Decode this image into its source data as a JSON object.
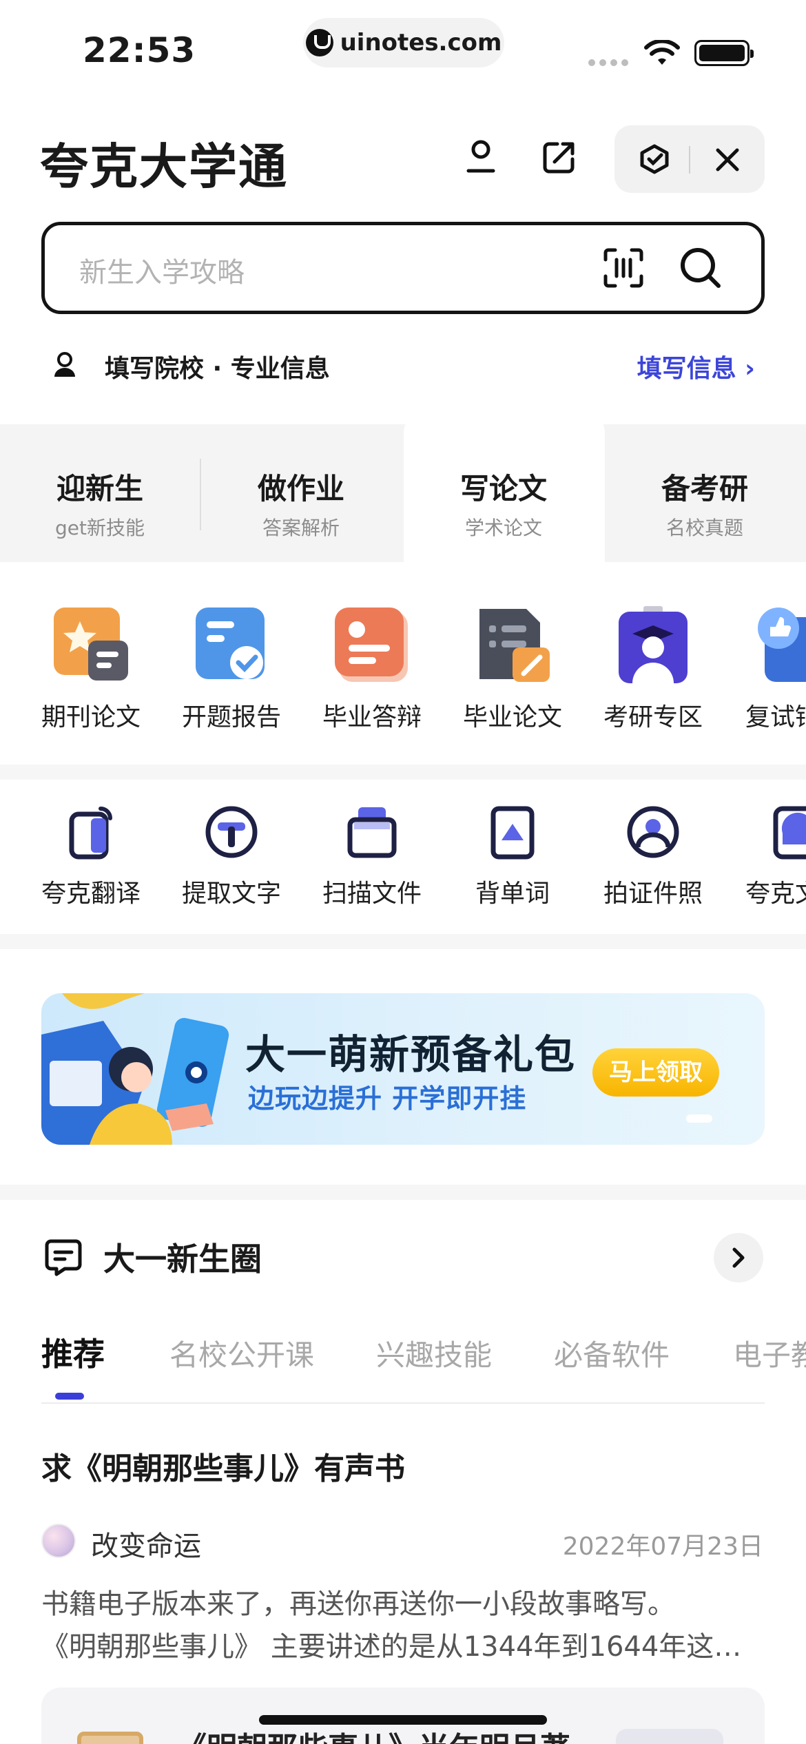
{
  "status_bar": {
    "time": "22:53",
    "url": "uinotes.com"
  },
  "header": {
    "title": "夸克大学通"
  },
  "search": {
    "placeholder": "新生入学攻略"
  },
  "info_row": {
    "label": "填写院校 · 专业信息",
    "link": "填写信息 ›"
  },
  "categories": [
    {
      "title": "迎新生",
      "sub": "get新技能"
    },
    {
      "title": "做作业",
      "sub": "答案解析"
    },
    {
      "title": "写论文",
      "sub": "学术论文",
      "active": true
    },
    {
      "title": "备考研",
      "sub": "名校真题"
    }
  ],
  "tools_row1": [
    {
      "label": "期刊论文",
      "icon": "journal-paper-icon"
    },
    {
      "label": "开题报告",
      "icon": "proposal-report-icon"
    },
    {
      "label": "毕业答辩",
      "icon": "graduation-defense-icon"
    },
    {
      "label": "毕业论文",
      "icon": "graduation-thesis-icon"
    },
    {
      "label": "考研专区",
      "icon": "postgrad-zone-icon"
    },
    {
      "label": "复试锦",
      "icon": "retest-icon"
    }
  ],
  "tools_row2": [
    {
      "label": "夸克翻译",
      "icon": "translate-icon"
    },
    {
      "label": "提取文字",
      "icon": "extract-text-icon"
    },
    {
      "label": "扫描文件",
      "icon": "scan-file-icon"
    },
    {
      "label": "背单词",
      "icon": "vocabulary-icon"
    },
    {
      "label": "拍证件照",
      "icon": "id-photo-icon"
    },
    {
      "label": "夸克文",
      "icon": "quark-doc-icon"
    }
  ],
  "banner": {
    "title": "大一萌新预备礼包",
    "subtitle": "边玩边提升 开学即开挂",
    "button": "马上领取"
  },
  "community": {
    "title": "大一新生圈",
    "tabs": [
      "推荐",
      "名校公开课",
      "兴趣技能",
      "必备软件",
      "电子教"
    ]
  },
  "post": {
    "title": "求《明朝那些事儿》有声书",
    "author": "改变命运",
    "date": "2022年07月23日",
    "body_line1": "书籍电子版本来了，再送你再送你一小段故事略写。",
    "body_line2": "《明朝那些事儿》 主要讲述的是从1344年到1644年这…",
    "card_title": "《明朝那些事儿》当年明月著"
  },
  "colors": {
    "accent": "#3c45d8",
    "banner_button": "#f8b400"
  }
}
